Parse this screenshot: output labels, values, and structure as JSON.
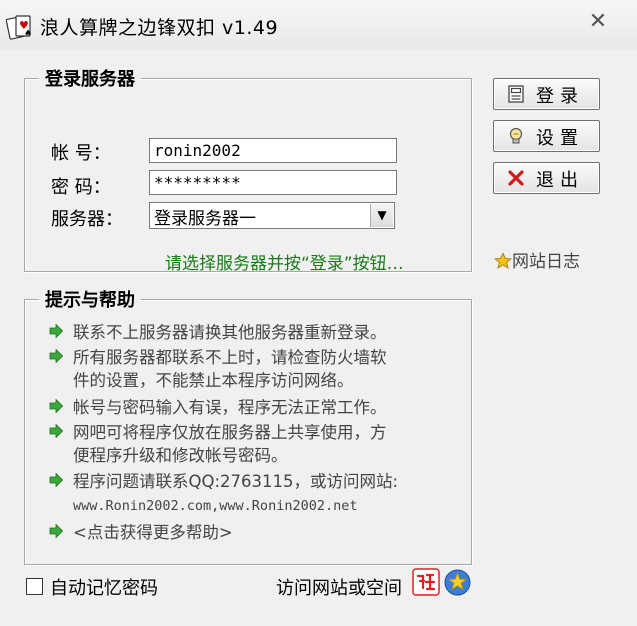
{
  "window": {
    "title": "浪人算牌之边锋双扣 v1.49",
    "close_glyph": "✕"
  },
  "login_group": {
    "title": "登录服务器",
    "account_label": "帐    号：",
    "account_value": "ronin2002",
    "password_label": "密    码：",
    "password_value": "*********",
    "server_label": "服务器：",
    "server_selected": "登录服务器一",
    "hint": "请选择服务器并按“登录”按钮…"
  },
  "buttons": {
    "login": "登录",
    "settings": "设置",
    "exit": "退出"
  },
  "weblog": "网站日志",
  "help_group": {
    "title": "提示与帮助",
    "items": [
      {
        "lines": [
          "联系不上服务器请换其他服务器重新登录。"
        ]
      },
      {
        "lines": [
          "所有服务器都联系不上时，请检查防火墙软",
          "件的设置，不能禁止本程序访问网络。"
        ]
      },
      {
        "lines": [
          "帐号与密码输入有误，程序无法正常工作。"
        ]
      },
      {
        "lines": [
          "网吧可将程序仅放在服务器上共享使用，方",
          "便程序升级和修改帐号密码。"
        ]
      },
      {
        "lines": [
          "程序问题请联系QQ:2763115，或访问网站:"
        ],
        "url": "www.Ronin2002.com,www.Ronin2002.net"
      },
      {
        "lines": [
          "<点击获得更多帮助>"
        ]
      }
    ]
  },
  "remember_password": {
    "label": "自动记忆密码",
    "checked": false
  },
  "visit_link": "访问网站或空间",
  "colors": {
    "hint_green": "#1a7a1a",
    "exit_red": "#d11a1a",
    "arrow_green": "#3aa83a"
  },
  "icons": {
    "app": "cards-app-icon",
    "login": "login-icon",
    "settings": "lightbulb-icon",
    "exit": "close-x-icon",
    "weblog": "star-icon",
    "help_bullet": "green-arrow-icon",
    "weibo": "weibo-icon",
    "qzone": "qzone-icon"
  }
}
